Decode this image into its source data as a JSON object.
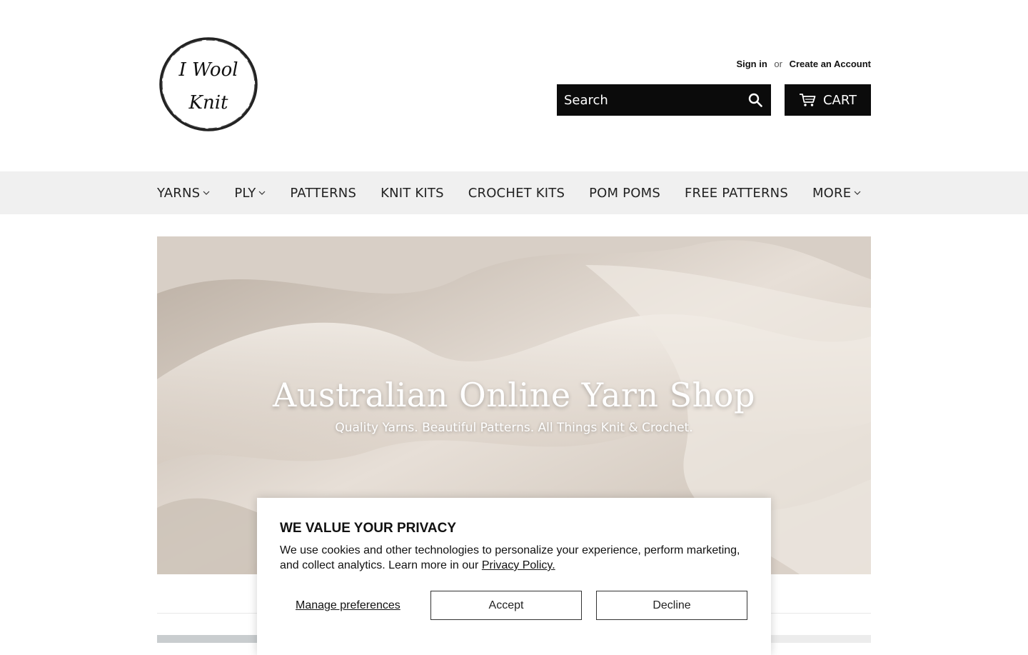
{
  "brand": {
    "logo_line1": "I Wool",
    "logo_line2": "Knit"
  },
  "account": {
    "sign_in": "Sign in",
    "or": "or",
    "create_account": "Create an Account"
  },
  "search": {
    "placeholder": "Search",
    "icon": "search-icon"
  },
  "cart": {
    "label": "CART",
    "icon": "cart-icon"
  },
  "nav": {
    "items": [
      {
        "label": "YARNS",
        "dropdown": true
      },
      {
        "label": "PLY",
        "dropdown": true
      },
      {
        "label": "PATTERNS",
        "dropdown": false
      },
      {
        "label": "KNIT KITS",
        "dropdown": false
      },
      {
        "label": "CROCHET KITS",
        "dropdown": false
      },
      {
        "label": "POM POMS",
        "dropdown": false
      },
      {
        "label": "FREE PATTERNS",
        "dropdown": false
      },
      {
        "label": "MORE",
        "dropdown": true
      }
    ]
  },
  "hero": {
    "title": "Australian Online Yarn Shop",
    "subtitle": "Quality Yarns. Beautiful Patterns. All Things Knit & Crochet."
  },
  "cookie": {
    "title": "WE VALUE YOUR PRIVACY",
    "text": "We use cookies and other technologies to personalize your experience, perform marketing, and collect analytics. Learn more in our",
    "policy_link": "Privacy Policy.",
    "manage": "Manage preferences",
    "accept": "Accept",
    "decline": "Decline"
  },
  "colors": {
    "header_bar": "#0b0b0b",
    "nav_bg": "#f0f0f0",
    "text": "#111111"
  }
}
